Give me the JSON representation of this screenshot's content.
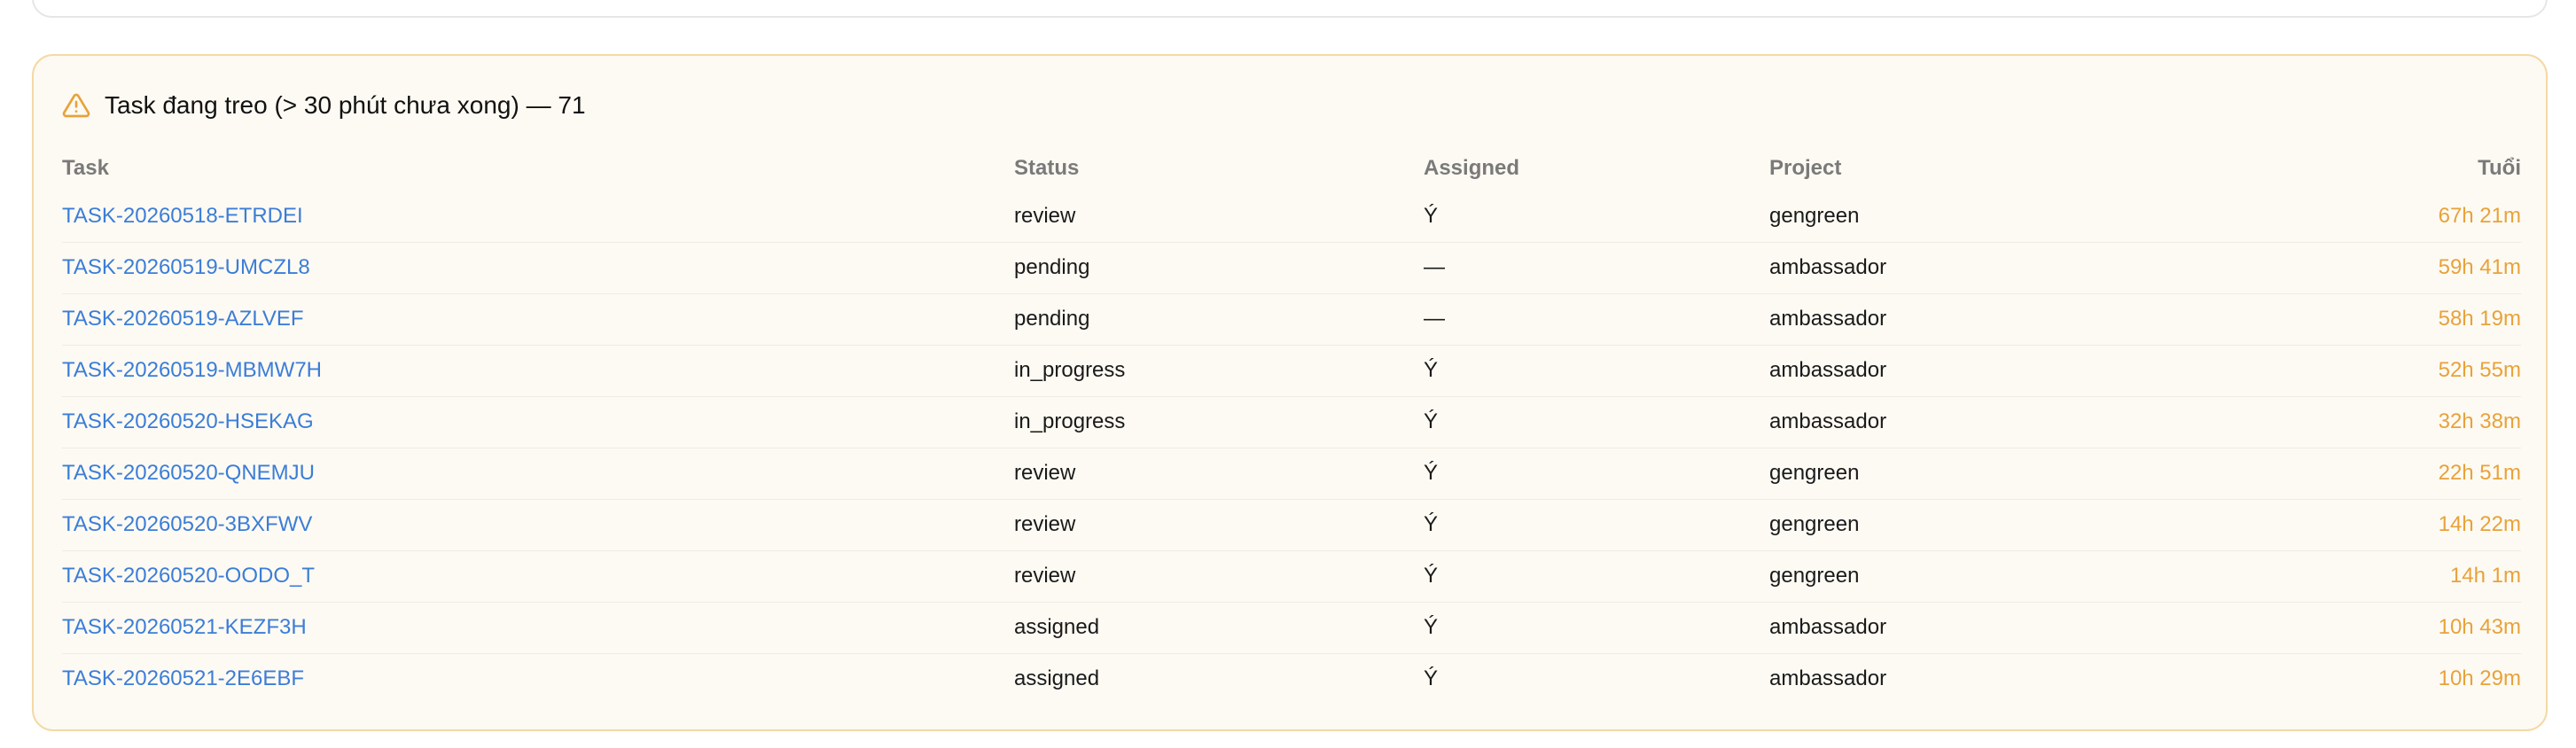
{
  "panel": {
    "title": "Task đang treo (> 30 phút chưa xong) — 71",
    "icon": "warning-icon",
    "accent_color": "#e8a23a",
    "link_color": "#3b7dd8"
  },
  "table": {
    "columns": {
      "task": "Task",
      "status": "Status",
      "assigned": "Assigned",
      "project": "Project",
      "age": "Tuổi"
    },
    "rows": [
      {
        "task": "TASK-20260518-ETRDEI",
        "status": "review",
        "assigned": "Ý",
        "project": "gengreen",
        "age": "67h 21m"
      },
      {
        "task": "TASK-20260519-UMCZL8",
        "status": "pending",
        "assigned": "—",
        "project": "ambassador",
        "age": "59h 41m"
      },
      {
        "task": "TASK-20260519-AZLVEF",
        "status": "pending",
        "assigned": "—",
        "project": "ambassador",
        "age": "58h 19m"
      },
      {
        "task": "TASK-20260519-MBMW7H",
        "status": "in_progress",
        "assigned": "Ý",
        "project": "ambassador",
        "age": "52h 55m"
      },
      {
        "task": "TASK-20260520-HSEKAG",
        "status": "in_progress",
        "assigned": "Ý",
        "project": "ambassador",
        "age": "32h 38m"
      },
      {
        "task": "TASK-20260520-QNEMJU",
        "status": "review",
        "assigned": "Ý",
        "project": "gengreen",
        "age": "22h 51m"
      },
      {
        "task": "TASK-20260520-3BXFWV",
        "status": "review",
        "assigned": "Ý",
        "project": "gengreen",
        "age": "14h 22m"
      },
      {
        "task": "TASK-20260520-OODO_T",
        "status": "review",
        "assigned": "Ý",
        "project": "gengreen",
        "age": "14h 1m"
      },
      {
        "task": "TASK-20260521-KEZF3H",
        "status": "assigned",
        "assigned": "Ý",
        "project": "ambassador",
        "age": "10h 43m"
      },
      {
        "task": "TASK-20260521-2E6EBF",
        "status": "assigned",
        "assigned": "Ý",
        "project": "ambassador",
        "age": "10h 29m"
      }
    ]
  }
}
